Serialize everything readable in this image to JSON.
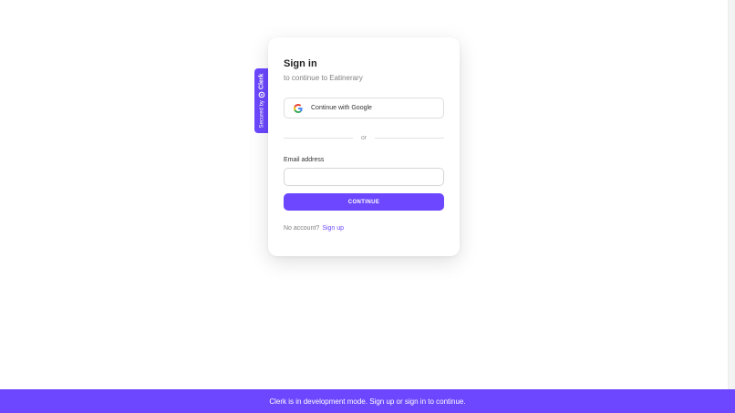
{
  "secured_tab": {
    "prefix": "Secured by",
    "brand": "Clerk",
    "icon": "clerk-logo-icon"
  },
  "card": {
    "title": "Sign in",
    "subtitle": "to continue to Eatinerary",
    "google_button": {
      "label": "Continue with Google",
      "icon": "google-icon"
    },
    "divider_text": "or",
    "email": {
      "label": "Email address",
      "value": "",
      "placeholder": ""
    },
    "continue_label": "CONTINUE",
    "no_account_text": "No account?",
    "signup_link": "Sign up"
  },
  "dev_banner": {
    "text": "Clerk is in development mode. Sign up or sign in to continue."
  },
  "colors": {
    "accent": "#6c47ff",
    "background": "#ffffff",
    "muted_text": "#808080"
  }
}
